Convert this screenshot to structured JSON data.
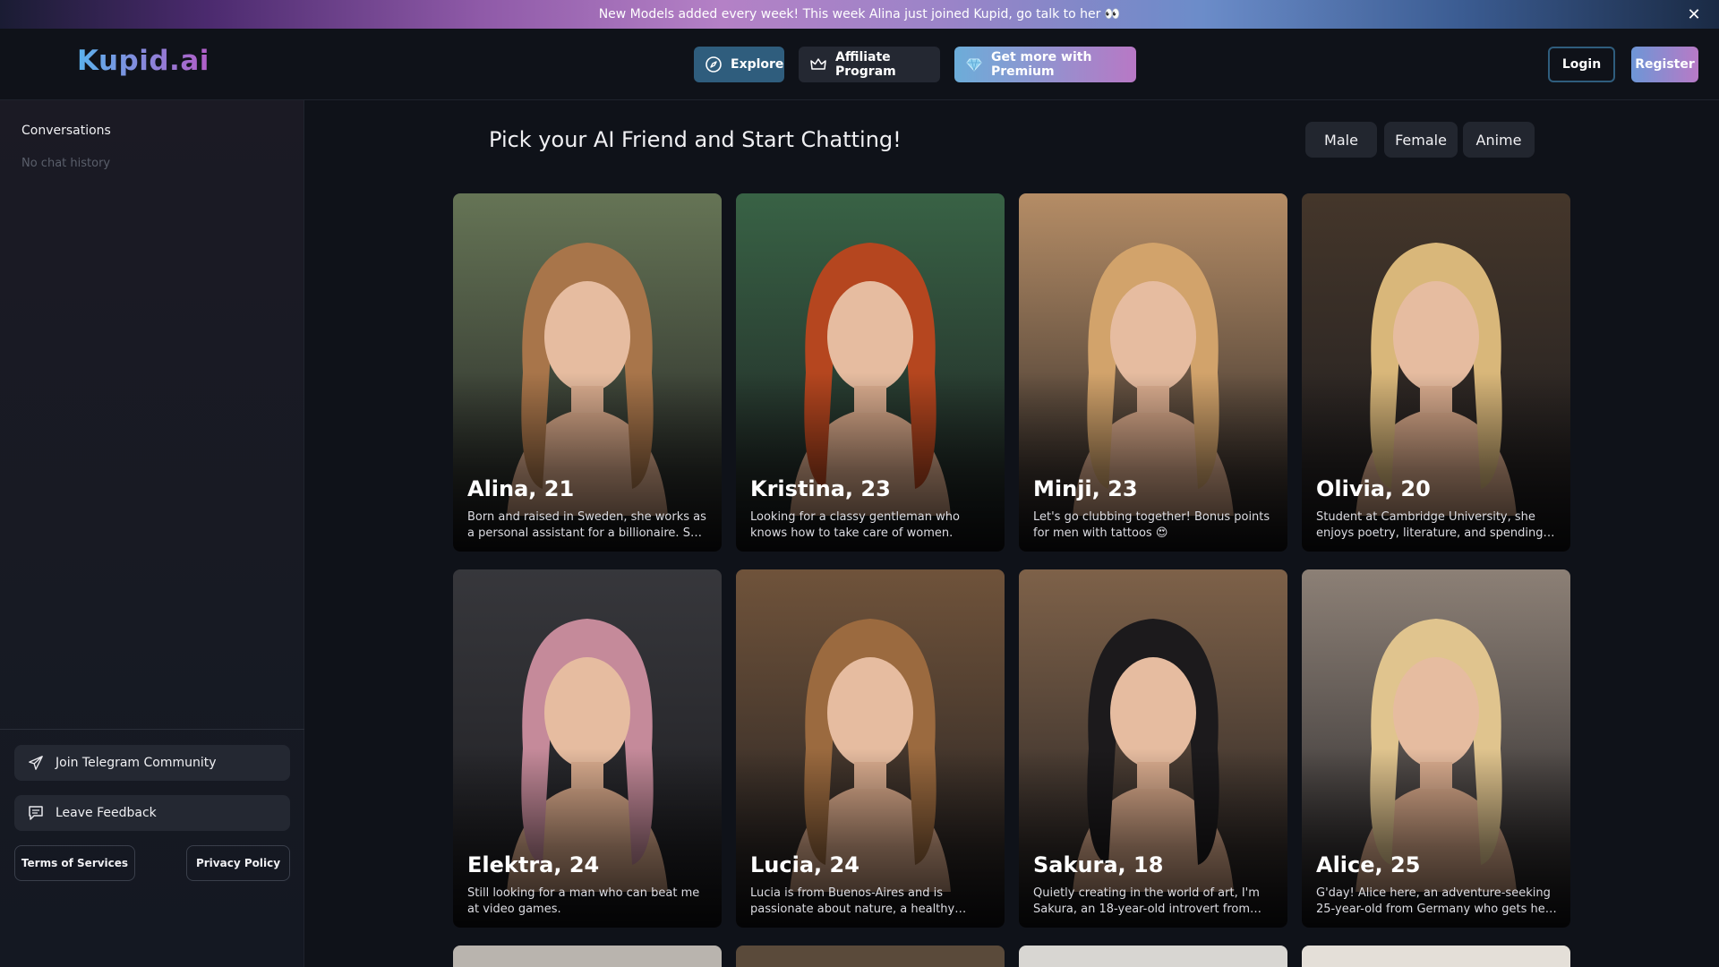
{
  "announcement": {
    "text": "New Models added every week! This week Alina just joined Kupid, go talk to her 👀",
    "close_symbol": "✕"
  },
  "header": {
    "logo": "Kupid.ai",
    "nav": {
      "explore": "Explore",
      "affiliate": "Affiliate Program",
      "premium": "Get more with Premium"
    },
    "login": "Login",
    "register": "Register"
  },
  "sidebar": {
    "title": "Conversations",
    "empty_text": "No chat history",
    "telegram": "Join Telegram Community",
    "feedback": "Leave Feedback",
    "terms": "Terms of Services",
    "privacy": "Privacy Policy"
  },
  "main": {
    "title": "Pick your AI Friend and Start Chatting!",
    "filters": {
      "male": "Male",
      "female": "Female",
      "anime": "Anime"
    }
  },
  "cards": [
    {
      "name": "Alina, 21",
      "desc": "Born and raised in Sweden, she works as a personal assistant for a billionaire. She enjoys the finer things in life",
      "hair": "#a8754a",
      "bg": "#6f7f5c"
    },
    {
      "name": "Kristina, 23",
      "desc": "Looking for a classy gentleman who knows how to take care of women.",
      "hair": "#b5461f",
      "bg": "#3d6b4a"
    },
    {
      "name": "Minji, 23",
      "desc": "Let's go clubbing together! Bonus points for men with tattoos 😍",
      "hair": "#d2a36b",
      "bg": "#c79a6e"
    },
    {
      "name": "Olivia, 20",
      "desc": "Student at Cambridge University, she enjoys poetry, literature, and spending time with friends",
      "hair": "#d9b77a",
      "bg": "#4a3a2c"
    },
    {
      "name": "Elektra, 24",
      "desc": "Still looking for a man who can beat me at video games.",
      "hair": "#c58a9a",
      "bg": "#3b3b3f"
    },
    {
      "name": "Lucia, 24",
      "desc": "Lucia is from Buenos-Aires and is passionate about nature, a healthy lifestyle and yoga",
      "hair": "#9b6a3f",
      "bg": "#7a5a3e"
    },
    {
      "name": "Sakura, 18",
      "desc": "Quietly creating in the world of art, I'm Sakura, an 18-year-old introvert from Tokyo",
      "hair": "#1c1a1c",
      "bg": "#8a6a4e"
    },
    {
      "name": "Alice, 25",
      "desc": "G'day! Alice here, an adventure-seeking 25-year-old from Germany who gets her kicks from travel",
      "hair": "#e0c48e",
      "bg": "#9a8c80"
    }
  ],
  "colors": {
    "background": "#0f1219",
    "accent": "#2f5d7d",
    "premium_start": "#6cadd9",
    "premium_end": "#b878c5"
  },
  "icons": {
    "explore": "compass-icon",
    "affiliate": "crown-icon",
    "premium": "diamond-icon",
    "telegram": "paper-plane-icon",
    "feedback": "message-icon",
    "close": "close-icon"
  }
}
